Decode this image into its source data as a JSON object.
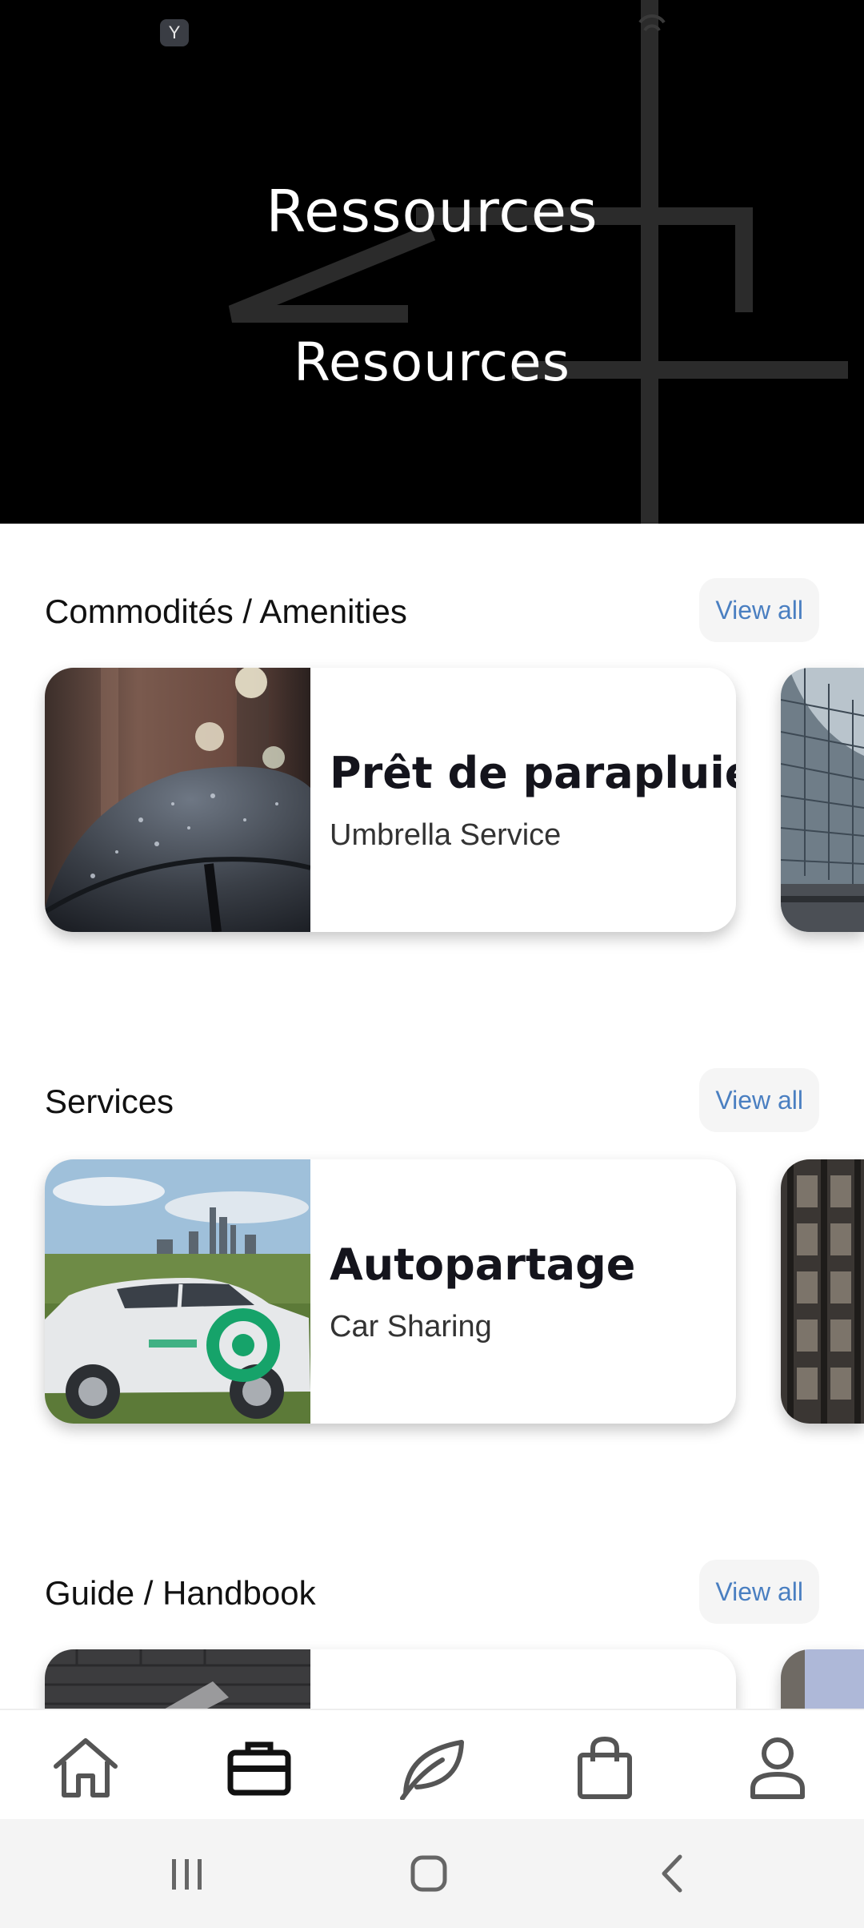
{
  "status_bar": {
    "badge_text": "Y"
  },
  "header": {
    "title_fr": "Ressources",
    "title_en": "Resources"
  },
  "sections": [
    {
      "title": "Commodités / Amenities",
      "view_all_label": "View all",
      "cards": [
        {
          "title": "Prêt de parapluies",
          "subtitle": "Umbrella Service",
          "image": "umbrella-photo"
        }
      ]
    },
    {
      "title": "Services",
      "view_all_label": "View all",
      "cards": [
        {
          "title": "Autopartage",
          "subtitle": "Car Sharing",
          "image": "car-photo"
        }
      ]
    },
    {
      "title": "Guide / Handbook",
      "view_all_label": "View all",
      "cards": []
    }
  ],
  "bottom_nav": {
    "items": [
      {
        "icon": "home-icon",
        "active": false
      },
      {
        "icon": "briefcase-icon",
        "active": true
      },
      {
        "icon": "leaf-icon",
        "active": false
      },
      {
        "icon": "shopping-bag-icon",
        "active": false
      },
      {
        "icon": "profile-icon",
        "active": false
      }
    ]
  },
  "system_nav": {
    "buttons": [
      "recent-apps-icon",
      "home-circle-icon",
      "back-icon"
    ]
  },
  "colors": {
    "accent": "#4a7fc1",
    "header_bg": "#000000",
    "active_icon": "#111111",
    "inactive_icon": "#555555"
  }
}
